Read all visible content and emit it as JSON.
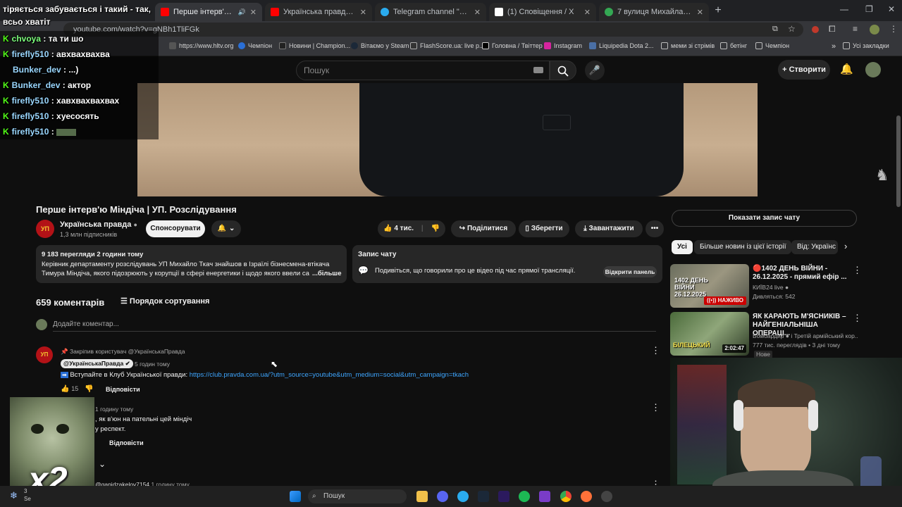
{
  "browser": {
    "tabs": [
      {
        "title": "Перше інтерв'ю Міндіча",
        "active": true,
        "color": "#ff0000"
      },
      {
        "title": "Українська правда - YouTube",
        "color": "#ff0000"
      },
      {
        "title": "Telegram channel \"netremba\"",
        "color": "#2aabee"
      },
      {
        "title": "(1) Сповіщення / X",
        "color": "#ffffff"
      },
      {
        "title": "7 вулиця Михайла Грушевсь",
        "color": "#34a853"
      }
    ],
    "top_text": "тіряється забувається і такий - так,",
    "url": "youtube.com/watch?v=gNBh1TliFGk",
    "bookmarks": [
      "https://www.hltv.org",
      "Чемпіон",
      "Новини | Champion...",
      "Вітаємо у Steam",
      "FlashScore.ua: live р...",
      "Головна / Твіттер",
      "Instagram",
      "Liquipedia Dota 2...",
      "меми зі стрімів",
      "бетінг",
      "Чемпіон",
      "Усі закладки"
    ]
  },
  "chat_overlay": [
    {
      "user": "",
      "text": "всьо хватіт"
    },
    {
      "user": "chvoya",
      "text": ": та ти шо"
    },
    {
      "user": "firefly510",
      "text": ": авхвахвахва"
    },
    {
      "user": "Bunker_dev",
      "text": ": ...)"
    },
    {
      "user": "Bunker_dev",
      "text": ": актор"
    },
    {
      "user": "firefly510",
      "text": ": хавхвахвахвах"
    },
    {
      "user": "firefly510",
      "text": ": хуесосять"
    },
    {
      "user": "firefly510",
      "text": ":"
    }
  ],
  "youtube": {
    "search_placeholder": "Пошук",
    "create_label": "Створити"
  },
  "video": {
    "title": "Перше інтерв'ю Міндіча | УП. Розслідування",
    "channel": "Українська правда",
    "channel_logo": "УП",
    "subscribers": "1,3 млн підписників",
    "sponsor": "Спонсорувати",
    "likes": "4 тис.",
    "share": "Поділитися",
    "save": "Зберегти",
    "download": "Завантажити",
    "views_line": "9 183 перегляди  2 години тому",
    "desc1": "Керівник департаменту розслідувань УП Михайло Ткач знайшов в Ізраїлі бізнесмена-втікача",
    "desc2": "Тимура Міндіча, якого підозрюють у корупції в сфері енергетики і щодо якого ввели са",
    "more": "...більше",
    "chat_title": "Запис чату",
    "chat_text": "Подивіться, що говорили про це відео під час прямої трансляції.",
    "chat_open": "Відкрити панель"
  },
  "comments": {
    "count": "659 коментарів",
    "sort": "Порядок сортування",
    "add": "Додайте коментар...",
    "pinned": "Закріпив користувач @УкраїнськаПравда",
    "c1_author": "@УкраїнськаПравда",
    "c1_time": "5 годин тому",
    "c1_text": "Вступайте в Клуб Української правди: ",
    "c1_link": "https://club.pravda.com.ua/?utm_source=youtube&utm_medium=social&utm_campaign=tkach",
    "c1_likes": "15",
    "reply": "Відповісти",
    "c2_time": "1 годину тому",
    "c2_text1": ", як в'юн на пательні цей міндіч",
    "c2_text2": "у респект.",
    "c3_author": "@ganidzakelov7154",
    "c3_time": "1 годину тому"
  },
  "sidebar": {
    "show_chat": "Показати запис чату",
    "chips": [
      "Усі",
      "Більше новин із цієї історії",
      "Від: Українс"
    ],
    "videos": [
      {
        "title1": "🔴1402 ДЕНЬ ВІЙНИ -",
        "title2": "26.12.2025 - прямий ефір ...",
        "channel": "КИЇВ24 live",
        "meta": "Дивляться: 542",
        "thumb_text": "1402 ДЕНЬ ВІЙНИ 26.12.2025",
        "badge": "НАЖИВО"
      },
      {
        "title1": "ЯК КАРАЮТЬ М'ЯСНИКІВ –",
        "title2": "НАЙГЕНІАЛЬНІША ОПЕРАЦІ...",
        "channel": "Бомбардир",
        "meta": "777 тис. переглядів • 3 дні тому",
        "tag": "Нове",
        "thumb_text": "БІЛЕЦЬКИЙ",
        "duration": "2:02:47",
        "channel_extra": "і Третій армійський кор..."
      }
    ]
  },
  "taskbar": {
    "search": "Пошук",
    "left_text1": "3",
    "left_text2": "Se"
  },
  "overlay_multiplier": "x2"
}
